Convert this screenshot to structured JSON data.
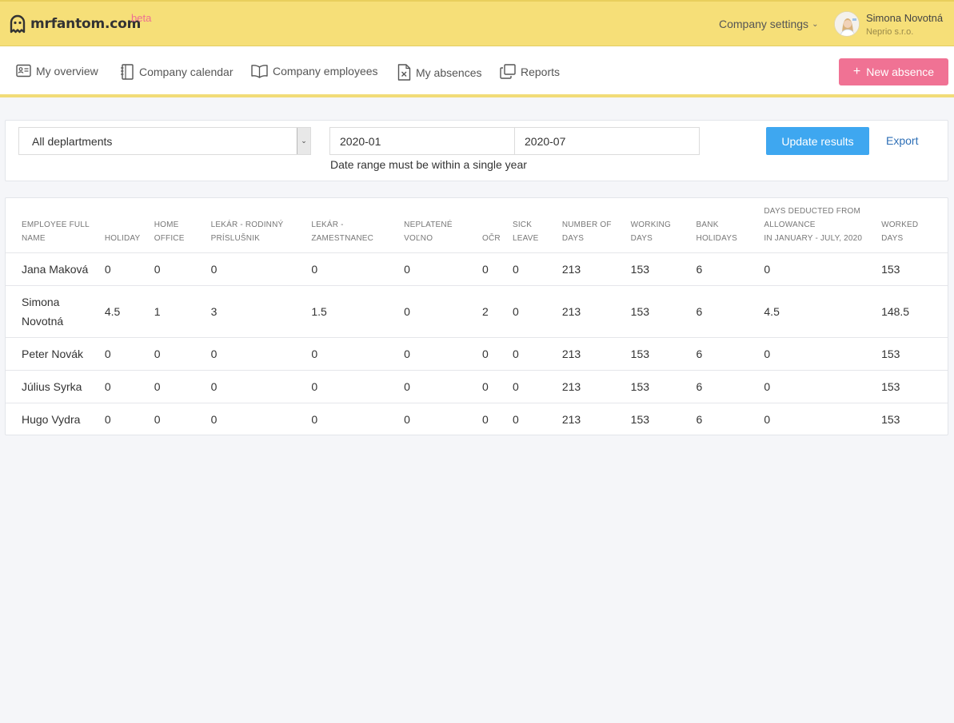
{
  "header": {
    "logo_text": "mrfantom.com",
    "logo_badge": "beta",
    "company_settings": "Company settings",
    "user_name": "Simona Novotná",
    "user_company": "Neprio s.r.o."
  },
  "nav": {
    "items": [
      {
        "label": "My overview",
        "icon": "id-card-icon"
      },
      {
        "label": "Company calendar",
        "icon": "notebook-icon"
      },
      {
        "label": "Company employees",
        "icon": "open-book-icon"
      },
      {
        "label": "My absences",
        "icon": "document-x-icon"
      },
      {
        "label": "Reports",
        "icon": "copy-pages-icon"
      }
    ],
    "new_absence": "New absence"
  },
  "filters": {
    "department": "All deplartments",
    "date_from": "2020-01",
    "date_to": "2020-07",
    "hint": "Date range must be within a single year",
    "update": "Update results",
    "export": "Export"
  },
  "table": {
    "columns": [
      [
        "EMPLOYEE FULL",
        "NAME"
      ],
      [
        "HOLIDAY"
      ],
      [
        "HOME",
        "OFFICE"
      ],
      [
        "LEKÁR - RODINNÝ",
        "PRÍSLUŠNIK"
      ],
      [
        "LEKÁR -",
        "ZAMESTNANEC"
      ],
      [
        "NEPLATENÉ",
        "VOĽNO"
      ],
      [
        "OČR"
      ],
      [
        "SICK",
        "LEAVE"
      ],
      [
        "NUMBER OF",
        "DAYS"
      ],
      [
        "WORKING",
        "DAYS"
      ],
      [
        "BANK",
        "HOLIDAYS"
      ],
      [
        "DAYS DEDUCTED FROM",
        "ALLOWANCE",
        "IN JANUARY - JULY, 2020"
      ],
      [
        "WORKED",
        "DAYS"
      ]
    ],
    "rows": [
      {
        "name": [
          "Jana Maková"
        ],
        "values": [
          "0",
          "0",
          "0",
          "0",
          "0",
          "0",
          "0",
          "213",
          "153",
          "6",
          "0",
          "153"
        ]
      },
      {
        "name": [
          "Simona",
          "Novotná"
        ],
        "values": [
          "4.5",
          "1",
          "3",
          "1.5",
          "0",
          "2",
          "0",
          "213",
          "153",
          "6",
          "4.5",
          "148.5"
        ]
      },
      {
        "name": [
          "Peter Novák"
        ],
        "values": [
          "0",
          "0",
          "0",
          "0",
          "0",
          "0",
          "0",
          "213",
          "153",
          "6",
          "0",
          "153"
        ]
      },
      {
        "name": [
          "Július Syrka"
        ],
        "values": [
          "0",
          "0",
          "0",
          "0",
          "0",
          "0",
          "0",
          "213",
          "153",
          "6",
          "0",
          "153"
        ]
      },
      {
        "name": [
          "Hugo Vydra"
        ],
        "values": [
          "0",
          "0",
          "0",
          "0",
          "0",
          "0",
          "0",
          "213",
          "153",
          "6",
          "0",
          "153"
        ]
      }
    ]
  },
  "colors": {
    "topbar": "#f6df78",
    "new_absence": "#f07294",
    "update_button": "#3ea7f0",
    "export_link": "#2e6fb6"
  }
}
